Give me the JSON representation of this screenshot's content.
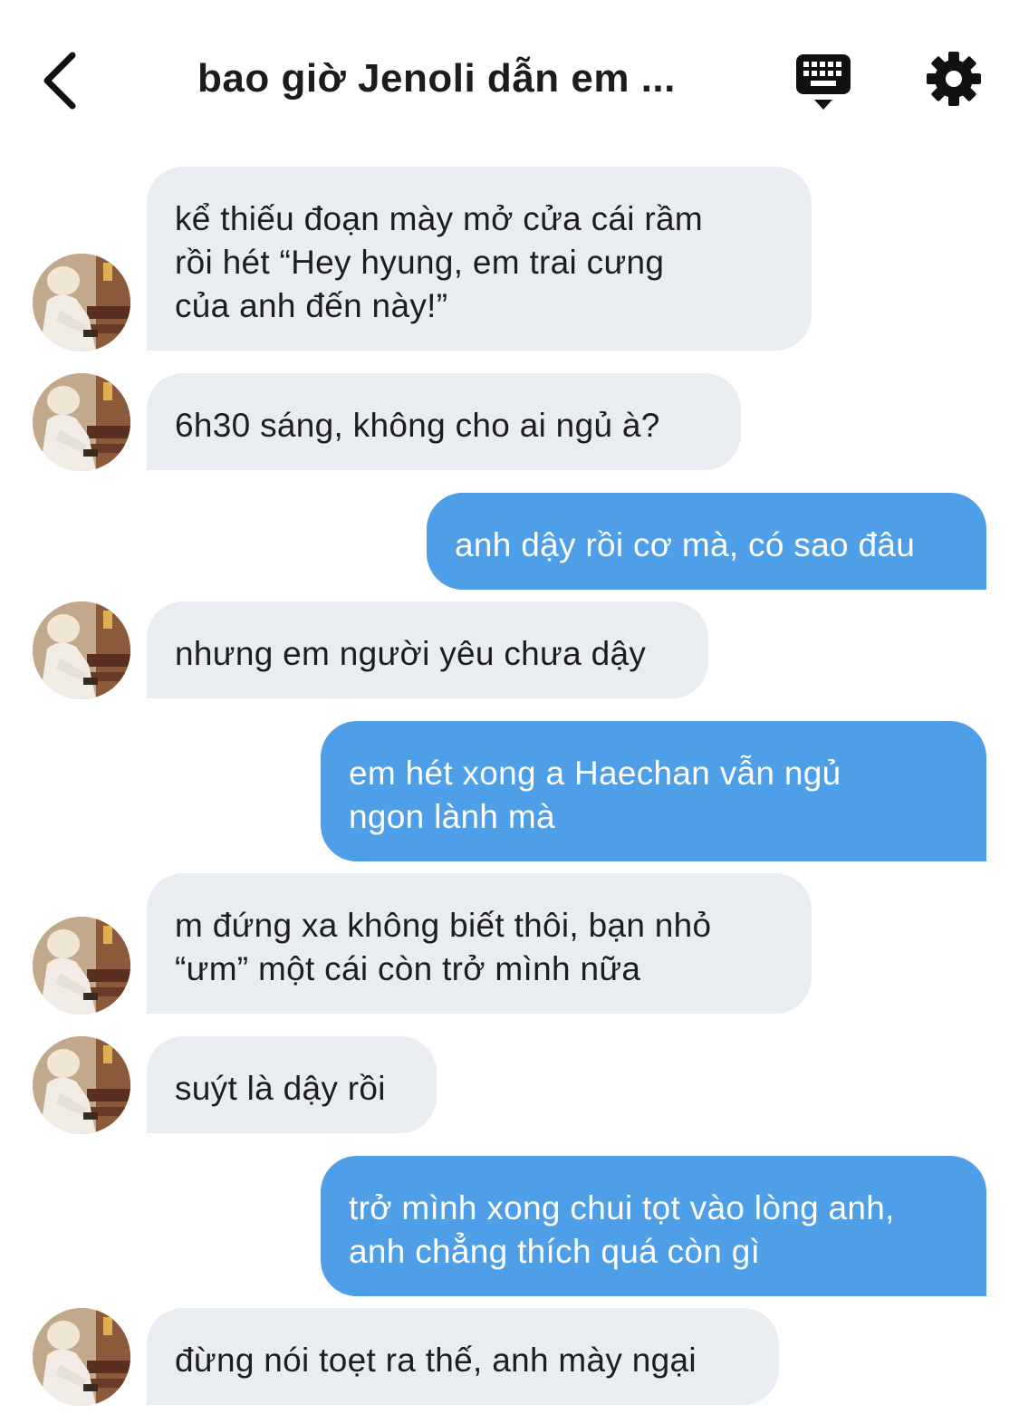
{
  "header": {
    "title": "bao giờ Jenoli dẫn em ...",
    "back_icon": "chevron-left-icon",
    "keyboard_icon": "keyboard-icon",
    "settings_icon": "gear-icon"
  },
  "colors": {
    "incoming_bubble": "#e9edf1",
    "outgoing_bubble": "#4f9ee8",
    "outgoing_text": "#ffffff",
    "incoming_text": "#1d1d1d"
  },
  "messages": [
    {
      "direction": "in",
      "text": "kể thiếu đoạn mày mở cửa cái rầm\nrồi hét “Hey hyung, em trai cưng\ncủa anh đến này!”"
    },
    {
      "direction": "in",
      "text": "6h30 sáng, không cho ai ngủ à?"
    },
    {
      "direction": "out",
      "text": "anh dậy rồi cơ mà, có sao đâu"
    },
    {
      "direction": "in",
      "text": "nhưng em người yêu chưa dậy"
    },
    {
      "direction": "out",
      "text": "em hét xong a Haechan vẫn ngủ\nngon lành mà"
    },
    {
      "direction": "in",
      "text": "m đứng xa không biết thôi, bạn nhỏ\n“ưm” một cái còn trở mình nữa"
    },
    {
      "direction": "in",
      "text": "suýt là dậy rồi"
    },
    {
      "direction": "out",
      "text": "trở mình xong chui tọt vào lòng anh,\nanh chẳng thích quá còn gì"
    },
    {
      "direction": "in",
      "text": "đừng nói toẹt ra thế, anh mày ngại"
    }
  ]
}
